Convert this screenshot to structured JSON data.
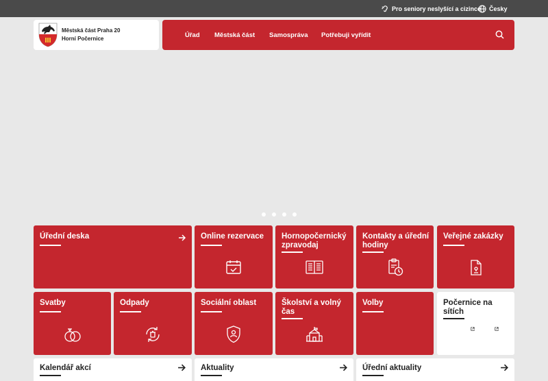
{
  "topbar": {
    "accessibility_label": "Pro seniory neslyšící a cizince",
    "language_label": "Česky"
  },
  "logo": {
    "line1": "Městská část Praha 20",
    "line2": "Horní Počernice"
  },
  "nav": {
    "items": [
      "Úřad",
      "Městská část",
      "Samospráva",
      "Potřebuji vyřídit"
    ]
  },
  "slider": {
    "slide_count": 4,
    "active_index": 0
  },
  "tiles": [
    {
      "title": "Úřední deska",
      "icon": "arrow-right-icon"
    },
    {
      "title": "Online rezervace",
      "icon": "calendar-check-icon"
    },
    {
      "title": "Hornopočernický zpravodaj",
      "icon": "newspaper-icon"
    },
    {
      "title": "Kontakty a úřední hodiny",
      "icon": "clipboard-clock-icon"
    },
    {
      "title": "Veřejné zakázky",
      "icon": "document-stamp-icon"
    },
    {
      "title": "Svatby",
      "icon": "wedding-rings-icon"
    },
    {
      "title": "Odpady",
      "icon": "recycle-bin-icon"
    },
    {
      "title": "Sociální oblast",
      "icon": "shield-person-icon"
    },
    {
      "title": "Školství a volný čas",
      "icon": "school-building-icon"
    },
    {
      "title": "Volby",
      "icon": ""
    },
    {
      "title": "Počernice na sítích",
      "icon": "external-link-icon"
    }
  ],
  "bottom_cards": [
    {
      "title": "Kalendář akcí"
    },
    {
      "title": "Aktuality"
    },
    {
      "title": "Úřední aktuality"
    }
  ],
  "colors": {
    "brand_red": "#c4262e",
    "topbar": "#4a4a4a",
    "background": "#e8e8e8"
  }
}
